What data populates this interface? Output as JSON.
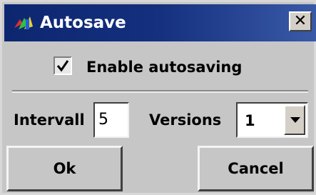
{
  "window": {
    "title": "Autosave",
    "close_glyph": "✕"
  },
  "checkbox": {
    "label": "Enable autosaving",
    "checked": true
  },
  "interval": {
    "label": "Intervall",
    "value": "5"
  },
  "versions": {
    "label": "Versions",
    "selected": "1"
  },
  "buttons": {
    "ok_label": "Ok",
    "cancel_label": "Cancel"
  },
  "colors": {
    "titlebar_start": "#0d2670",
    "titlebar_end": "#3a5aa8",
    "window_bg": "#c6c6c6"
  },
  "icons": {
    "app": "app-icon",
    "close": "close-icon",
    "check": "check-icon",
    "dropdown": "chevron-down-icon"
  }
}
